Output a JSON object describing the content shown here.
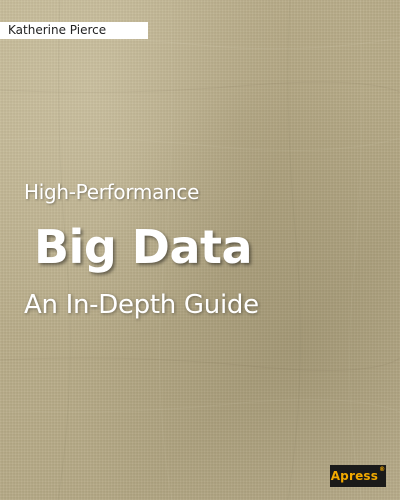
{
  "cover": {
    "author": "Katherine Pierce",
    "series_line": "High-Performance",
    "title": "Big Data",
    "subtitle": "An In-Depth Guide",
    "publisher": "Apress",
    "publisher_mark": "®"
  },
  "colors": {
    "background": "#b9ad8a",
    "title_text": "#ffffff",
    "author_box": "#ffffff",
    "publisher_box": "#1a1a1a",
    "publisher_text": "#f2a900"
  }
}
